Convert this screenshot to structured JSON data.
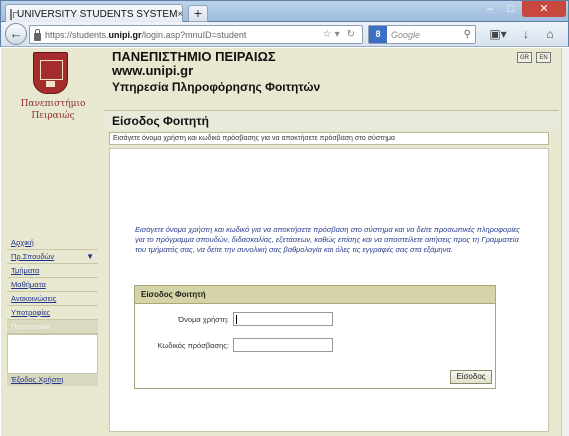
{
  "browser": {
    "tab_title": "UNIVERSITY STUDENTS SYSTEM",
    "tab_close": "×",
    "new_tab": "+",
    "url_prefix": "https://students.",
    "url_domain": "unipi.gr",
    "url_path": "/login.asp?mnuID=student",
    "search_engine": "8",
    "search_placeholder": "Google"
  },
  "header": {
    "logo_line1": "Πανεπιστήμιο",
    "logo_line2": "Πειραιώς",
    "title": "ΠΑΝΕΠΙΣΤΗΜΙΟ ΠΕΙΡΑΙΩΣ",
    "url": "www.unipi.gr",
    "subtitle": "Υπηρεσία Πληροφόρησης Φοιτητών",
    "lang_gr": "GR",
    "lang_en": "EN"
  },
  "page": {
    "section_title": "Είσοδος Φοιτητή",
    "info": "Εισάγετε όνομα χρήστη και κωδικό πρόσβασης για να αποκτήσετε πρόσβαση στο σύστημα",
    "intro": "Εισάγετε όνομα χρήστη και κωδικό για να αποκτήσετε πρόσβαση στο σύστημα και να δείτε προσωπικές πληροφορίες για το πρόγραμμα σπουδών, διδασκαλίας, εξετάσεων, καθώς επίσης και να αποστείλετε αιτήσεις προς τη Γραμματεία του τμήματός σας, να δείτε την συνολική σας βαθμολογία και όλες τις εγγραφές σας στα εξάμηνα."
  },
  "login": {
    "header": "Είσοδος Φοιτητή",
    "username_label": "Όνομα χρήστη:",
    "password_label": "Κωδικός πρόσβασης:",
    "submit_label": "Είσοδος"
  },
  "sidebar": {
    "items": [
      {
        "label": "Αρχική"
      },
      {
        "label": "Πρ.Σπουδών"
      },
      {
        "label": "Τμήματα"
      },
      {
        "label": "Μαθήματα"
      },
      {
        "label": "Ανακοινώσεις"
      },
      {
        "label": "Υποτροφίες"
      },
      {
        "label": "Προσωπικά"
      }
    ],
    "logout": "Έξοδος Χρήστη"
  }
}
